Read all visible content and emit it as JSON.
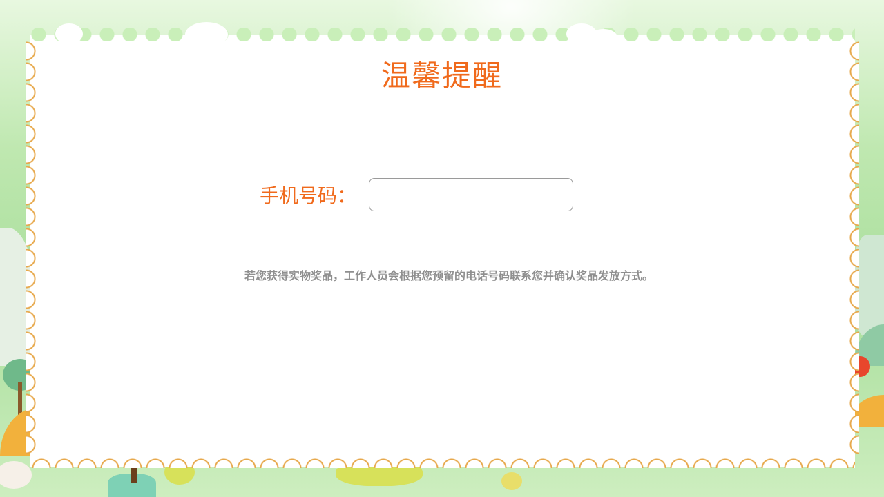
{
  "dialog": {
    "title": "温馨提醒",
    "phone_label": "手机号码：",
    "phone_value": "",
    "note": "若您获得实物奖品，工作人员会根据您预留的电话号码联系您并确认奖品发放方式。"
  },
  "colors": {
    "accent": "#f06a1c",
    "stamp_edge": "#e7a84b",
    "background_green": "#a9de9c",
    "note_text": "#8f8f8f"
  }
}
